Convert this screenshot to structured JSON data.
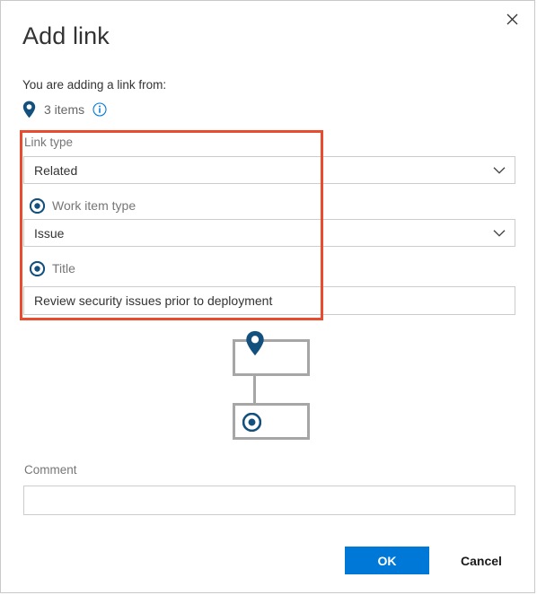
{
  "dialog": {
    "title": "Add link",
    "close_label": "close-icon"
  },
  "source": {
    "prompt": "You are adding a link from:",
    "pin_icon": "map-pin-icon",
    "items_count": "3 items",
    "info_icon": "info-icon"
  },
  "form": {
    "link_type": {
      "label": "Link type",
      "value": "Related",
      "chevron": "chevron-down-icon"
    },
    "work_item_type": {
      "radio_icon": "radio-selected-icon",
      "label": "Work item type",
      "value": "Issue",
      "chevron": "chevron-down-icon"
    },
    "title": {
      "radio_icon": "radio-selected-icon",
      "label": "Title",
      "value": "Review security issues prior to deployment"
    },
    "comment": {
      "label": "Comment",
      "value": "",
      "placeholder": ""
    }
  },
  "diagram": {
    "parent_icon": "map-pin-icon",
    "child_icon": "radio-selected-icon"
  },
  "footer": {
    "ok_label": "OK",
    "cancel_label": "Cancel"
  },
  "colors": {
    "accent_blue": "#0078d7",
    "icon_blue": "#13507e",
    "annotation_red": "#e74c2e",
    "diagram_gray": "#a6a6a6",
    "border_gray": "#cccccc",
    "label_gray": "#767676"
  }
}
